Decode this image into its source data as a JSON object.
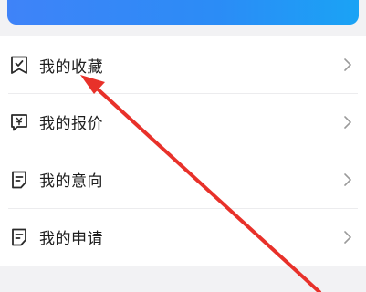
{
  "menu": {
    "items": [
      {
        "label": "我的收藏",
        "icon": "bookmark-check-icon"
      },
      {
        "label": "我的报价",
        "icon": "quote-yen-icon"
      },
      {
        "label": "我的意向",
        "icon": "document-icon"
      },
      {
        "label": "我的申请",
        "icon": "document-icon"
      }
    ]
  },
  "colors": {
    "banner_start": "#3f83f8",
    "banner_end": "#1aa3f5",
    "annotation_arrow": "#e8312a"
  }
}
